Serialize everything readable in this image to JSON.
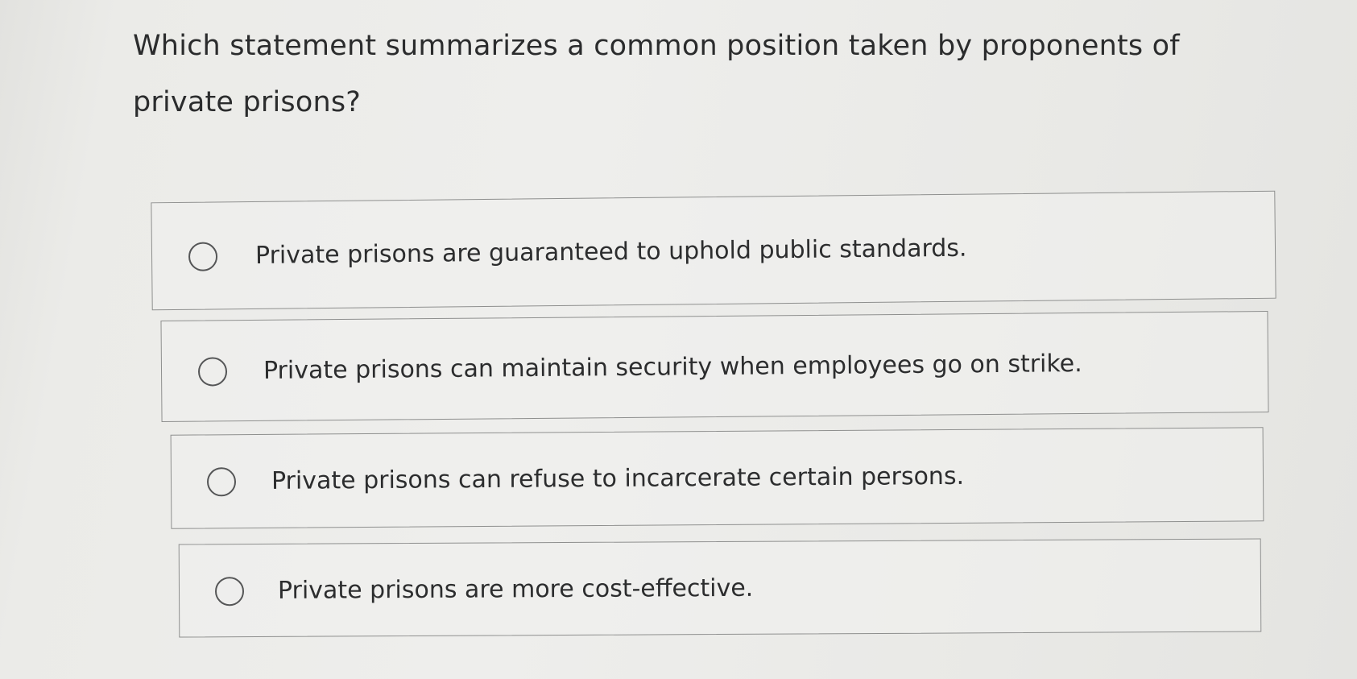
{
  "question": {
    "text": "Which statement summarizes a common position taken by proponents of private prisons?"
  },
  "options": [
    {
      "label": "Private prisons are guaranteed to uphold public standards.",
      "selected": false
    },
    {
      "label": "Private prisons can maintain security when employees go on strike.",
      "selected": false
    },
    {
      "label": "Private prisons can refuse to incarcerate certain persons.",
      "selected": false
    },
    {
      "label": "Private prisons are more cost-effective.",
      "selected": false
    }
  ]
}
